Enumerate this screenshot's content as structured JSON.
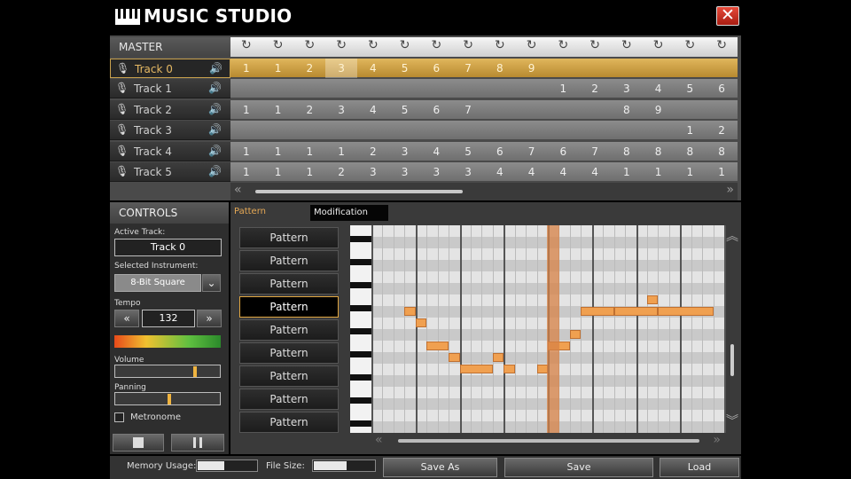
{
  "app": {
    "title": "MUSIC STUDIO",
    "close_label": "✕"
  },
  "arranger": {
    "master_label": "MASTER",
    "loop_icon": "↻",
    "columns": 16,
    "tracks": [
      {
        "name": "Track 0",
        "active": true,
        "cells": [
          "1",
          "1",
          "2",
          "3",
          "4",
          "5",
          "6",
          "7",
          "8",
          "9",
          "",
          "",
          "",
          "",
          "",
          ""
        ],
        "highlight": 3
      },
      {
        "name": "Track 1",
        "active": false,
        "cells": [
          "",
          "",
          "",
          "",
          "",
          "",
          "",
          "",
          "",
          "",
          "1",
          "2",
          "3",
          "4",
          "5",
          "6"
        ]
      },
      {
        "name": "Track 2",
        "active": false,
        "cells": [
          "1",
          "1",
          "2",
          "3",
          "4",
          "5",
          "6",
          "7",
          "",
          "",
          "",
          "",
          "8",
          "9",
          "",
          ""
        ]
      },
      {
        "name": "Track 3",
        "active": false,
        "cells": [
          "",
          "",
          "",
          "",
          "",
          "",
          "",
          "",
          "",
          "",
          "",
          "",
          "",
          "",
          "1",
          "2"
        ]
      },
      {
        "name": "Track 4",
        "active": false,
        "cells": [
          "1",
          "1",
          "1",
          "1",
          "2",
          "3",
          "4",
          "5",
          "6",
          "7",
          "6",
          "7",
          "8",
          "8",
          "8",
          "8"
        ]
      },
      {
        "name": "Track 5",
        "active": false,
        "cells": [
          "1",
          "1",
          "1",
          "2",
          "3",
          "3",
          "3",
          "3",
          "4",
          "4",
          "4",
          "4",
          "1",
          "1",
          "1",
          "1"
        ]
      }
    ],
    "scroll_position": 0.45
  },
  "controls": {
    "title": "CONTROLS",
    "active_track_label": "Active Track:",
    "active_track_value": "Track 0",
    "instrument_label": "Selected Instrument:",
    "instrument_value": "8-Bit Square",
    "tempo_label": "Tempo",
    "tempo_value": "132",
    "volume_label": "Volume",
    "volume_level": 0.77,
    "panning_label": "Panning",
    "panning_level": 0.52,
    "metronome_label": "Metronome",
    "metronome_checked": false
  },
  "pattern_editor": {
    "tab_pattern": "Pattern",
    "tab_modification": "Modification",
    "pattern_buttons": [
      "Pattern",
      "Pattern",
      "Pattern",
      "Pattern",
      "Pattern",
      "Pattern",
      "Pattern",
      "Pattern",
      "Pattern"
    ],
    "selected_pattern": 3,
    "playhead_step": 16,
    "notes": [
      {
        "step": 3,
        "row": 7,
        "len": 1
      },
      {
        "step": 4,
        "row": 8,
        "len": 1
      },
      {
        "step": 5,
        "row": 10,
        "len": 2
      },
      {
        "step": 7,
        "row": 11,
        "len": 1
      },
      {
        "step": 8,
        "row": 12,
        "len": 3
      },
      {
        "step": 11,
        "row": 11,
        "len": 1
      },
      {
        "step": 12,
        "row": 12,
        "len": 1
      },
      {
        "step": 15,
        "row": 12,
        "len": 1
      },
      {
        "step": 16,
        "row": 10,
        "len": 2
      },
      {
        "step": 18,
        "row": 9,
        "len": 1
      },
      {
        "step": 19,
        "row": 7,
        "len": 3
      },
      {
        "step": 22,
        "row": 7,
        "len": 4
      },
      {
        "step": 25,
        "row": 6,
        "len": 1
      },
      {
        "step": 26,
        "row": 7,
        "len": 5
      }
    ]
  },
  "footer": {
    "memory_label": "Memory Usage:",
    "memory_level": 0.45,
    "filesize_label": "File Size:",
    "filesize_level": 0.55,
    "save_as": "Save As",
    "save": "Save",
    "load": "Load"
  }
}
